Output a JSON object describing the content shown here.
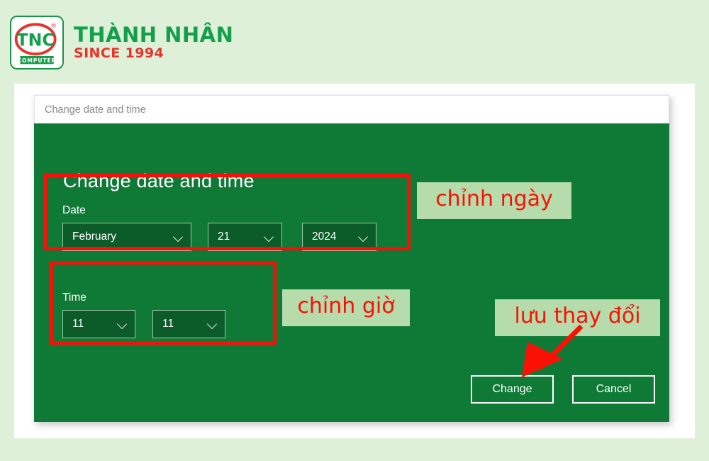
{
  "brand": {
    "logo_icon": "tnc-computer-logo",
    "logo_monogram": "TNC",
    "logo_subtext": "COMPUTER",
    "logo_trademark": "®",
    "name": "THÀNH NHÂN",
    "since": "SINCE 1994"
  },
  "dialog": {
    "titlebar_text": "Change date and time",
    "heading": "Change date and time",
    "date": {
      "label": "Date",
      "month": "February",
      "day": "21",
      "year": "2024",
      "chevron_icon": "chevron-down-icon"
    },
    "time": {
      "label": "Time",
      "hour": "11",
      "minute": "11",
      "chevron_icon": "chevron-down-icon"
    },
    "buttons": {
      "change": "Change",
      "cancel": "Cancel"
    }
  },
  "annotations": {
    "date_callout": "chỉnh ngày",
    "time_callout": "chỉnh giờ",
    "save_callout": "lưu thay đổi",
    "arrow_icon": "red-arrow-down-left-icon"
  },
  "colors": {
    "page_background": "#dff0d8",
    "dialog_green": "#0f7a35",
    "dropdown_fill": "#0c5c2a",
    "annotation_red": "#fb1005",
    "callout_background": "#b6dcab",
    "brand_green": "#13a04a",
    "brand_red": "#e8322c"
  }
}
